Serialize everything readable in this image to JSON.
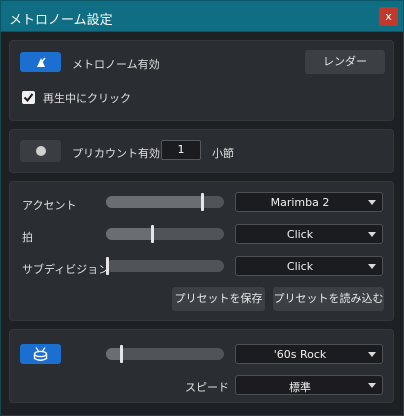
{
  "window": {
    "title": "メトロノーム設定",
    "close_label": "x"
  },
  "metronome": {
    "enable_label": "メトロノーム有効",
    "render_label": "レンダー",
    "play_click_label": "再生中にクリック",
    "play_click_checked": true,
    "enabled": true
  },
  "precount": {
    "enable_label": "プリカウント有効",
    "enabled": false,
    "bars_value": "1",
    "bars_unit": "小節"
  },
  "sounds": {
    "rows": [
      {
        "label": "アクセント",
        "level": 0.82,
        "sound": "Marimba 2"
      },
      {
        "label": "拍",
        "level": 0.39,
        "sound": "Click"
      },
      {
        "label": "サブディビジョン",
        "level": 0.0,
        "sound": "Click"
      }
    ],
    "save_preset_label": "プリセットを保存",
    "load_preset_label": "プリセットを読み込む"
  },
  "groove": {
    "enabled": true,
    "level": 0.13,
    "style": "'60s Rock",
    "speed_label": "スピード",
    "speed_value": "標準"
  },
  "colors": {
    "accent": "#1b6fd1",
    "titlebar": "#0f6d84",
    "close": "#c0392b"
  }
}
